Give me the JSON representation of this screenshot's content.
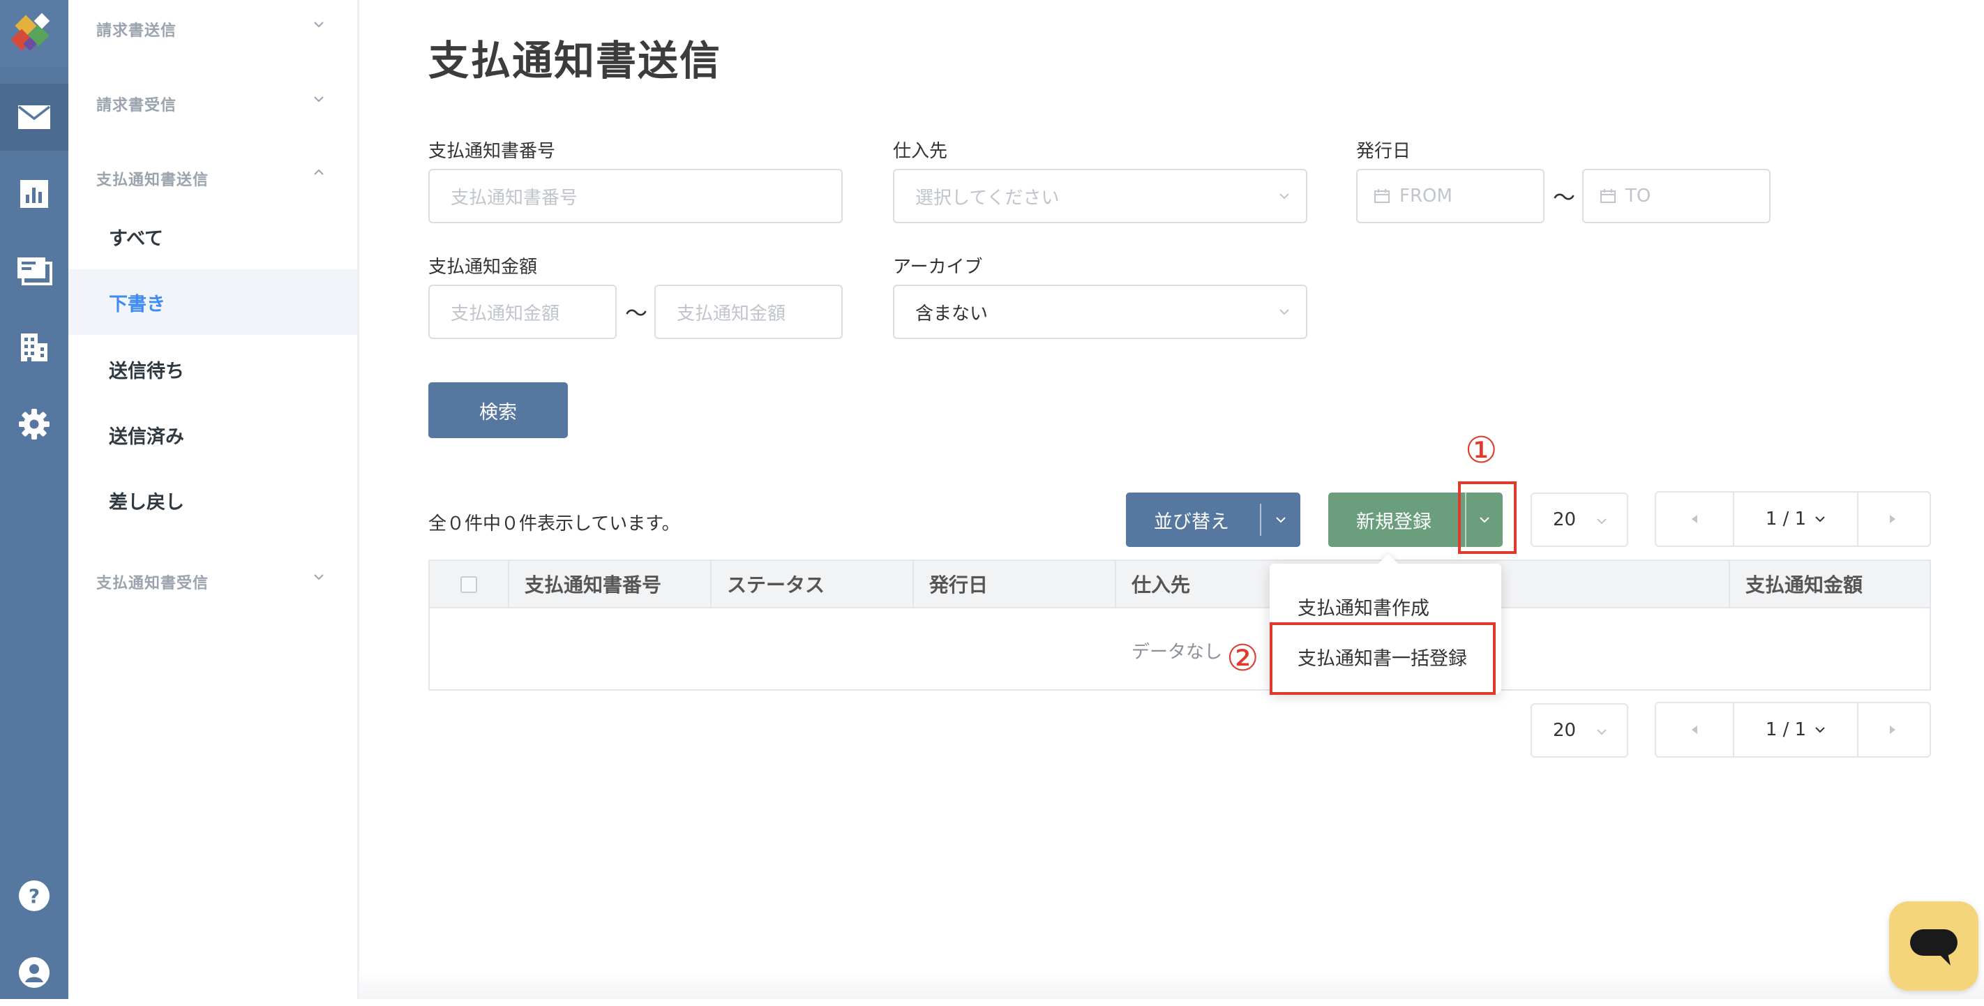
{
  "sidebar": {
    "groups": [
      {
        "label": "請求書送信",
        "expanded": false
      },
      {
        "label": "請求書受信",
        "expanded": false
      },
      {
        "label": "支払通知書送信",
        "expanded": true
      },
      {
        "label": "支払通知書受信",
        "expanded": false
      }
    ],
    "items": [
      {
        "label": "すべて",
        "active": false
      },
      {
        "label": "下書き",
        "active": true
      },
      {
        "label": "送信待ち",
        "active": false
      },
      {
        "label": "送信済み",
        "active": false
      },
      {
        "label": "差し戻し",
        "active": false
      }
    ]
  },
  "rail_icons": [
    "logo",
    "mail-icon",
    "chart-icon",
    "invoice-icon",
    "building-icon",
    "gear-icon",
    "help-icon",
    "user-icon"
  ],
  "page": {
    "title": "支払通知書送信"
  },
  "filters": {
    "number": {
      "label": "支払通知書番号",
      "placeholder": "支払通知書番号"
    },
    "supplier": {
      "label": "仕入先",
      "placeholder": "選択してください"
    },
    "issue_date": {
      "label": "発行日",
      "from": "FROM",
      "to": "TO"
    },
    "amount": {
      "label": "支払通知金額",
      "from_placeholder": "支払通知金額",
      "to_placeholder": "支払通知金額"
    },
    "archive": {
      "label": "アーカイブ",
      "value": "含まない"
    },
    "tilde": "〜"
  },
  "search_button": "検索",
  "result_count": "全０件中０件表示しています。",
  "toolbar": {
    "sort_label": "並び替え",
    "new_label": "新規登録",
    "page_size": "20",
    "page_indicator": "1 / 1"
  },
  "annotations": {
    "one": "①",
    "two": "②"
  },
  "dropdown": {
    "items": [
      "支払通知書作成",
      "支払通知書一括登録"
    ]
  },
  "table": {
    "columns": [
      "支払通知書番号",
      "ステータス",
      "発行日",
      "仕入先",
      "支払通知金額"
    ],
    "empty_text": "データなし"
  },
  "colors": {
    "rail": "#56779f",
    "accent": "#3f8cf0",
    "new_button": "#6b9e7c",
    "annotation": "#e03a2e",
    "help_bubble": "#f5d57c"
  }
}
